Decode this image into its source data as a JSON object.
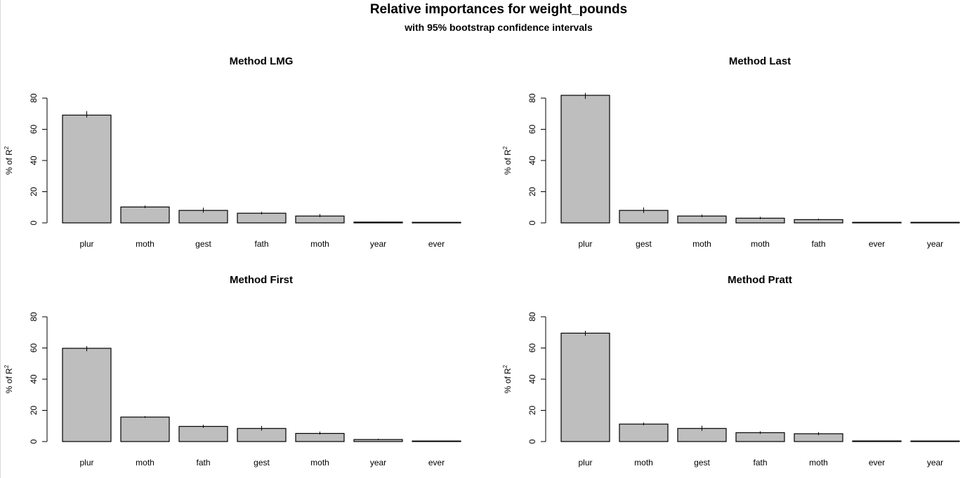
{
  "chart_data": {
    "title": "Relative importances for weight_pounds",
    "subtitle": "with 95% bootstrap confidence intervals",
    "panels": [
      {
        "type": "bar",
        "title": "Method LMG",
        "ylabel": "% of R",
        "ylabel_superscript": "2",
        "ylim": [
          0,
          80
        ],
        "yticks": [
          0,
          20,
          40,
          60,
          80
        ],
        "bar_color": "#bebebe",
        "categories": [
          "plur",
          "moth",
          "gest",
          "fath",
          "moth",
          "year",
          "ever"
        ],
        "values": [
          69.1,
          10.2,
          8.0,
          6.2,
          4.4,
          0.5,
          0.3
        ],
        "ci_lower": [
          67.6,
          9.5,
          6.6,
          5.5,
          3.7,
          0.3,
          0.2
        ],
        "ci_upper": [
          71.7,
          11.1,
          9.8,
          7.1,
          5.6,
          0.8,
          0.5
        ]
      },
      {
        "type": "bar",
        "title": "Method Last",
        "ylabel": "% of R",
        "ylabel_superscript": "2",
        "ylim": [
          0,
          80
        ],
        "yticks": [
          0,
          20,
          40,
          60,
          80
        ],
        "bar_color": "#bebebe",
        "categories": [
          "plur",
          "gest",
          "moth",
          "moth",
          "fath",
          "ever",
          "year"
        ],
        "values": [
          81.8,
          8.0,
          4.4,
          3.0,
          2.1,
          0.1,
          0.05
        ],
        "ci_lower": [
          79.5,
          6.4,
          3.7,
          2.4,
          1.7,
          0.0,
          0.0
        ],
        "ci_upper": [
          83.3,
          9.9,
          5.3,
          3.9,
          2.7,
          0.3,
          0.1
        ]
      },
      {
        "type": "bar",
        "title": "Method First",
        "ylabel": "% of R",
        "ylabel_superscript": "2",
        "ylim": [
          0,
          80
        ],
        "yticks": [
          0,
          20,
          40,
          60,
          80
        ],
        "bar_color": "#bebebe",
        "categories": [
          "plur",
          "moth",
          "fath",
          "gest",
          "moth",
          "year",
          "ever"
        ],
        "values": [
          59.8,
          15.7,
          9.7,
          8.4,
          5.2,
          1.3,
          0.3
        ],
        "ci_lower": [
          57.9,
          15.2,
          8.8,
          7.0,
          4.5,
          0.9,
          0.2
        ],
        "ci_upper": [
          61.2,
          16.3,
          10.8,
          10.0,
          6.4,
          1.8,
          0.5
        ]
      },
      {
        "type": "bar",
        "title": "Method Pratt",
        "ylabel": "% of R",
        "ylabel_superscript": "2",
        "ylim": [
          0,
          80
        ],
        "yticks": [
          0,
          20,
          40,
          60,
          80
        ],
        "bar_color": "#bebebe",
        "categories": [
          "plur",
          "moth",
          "gest",
          "fath",
          "moth",
          "ever",
          "year"
        ],
        "values": [
          69.5,
          11.2,
          8.4,
          5.7,
          5.0,
          0.4,
          0.05
        ],
        "ci_lower": [
          67.8,
          10.4,
          6.9,
          4.9,
          4.1,
          0.3,
          0.0
        ],
        "ci_upper": [
          71.0,
          12.2,
          10.1,
          6.6,
          6.0,
          0.6,
          0.1
        ]
      }
    ]
  }
}
